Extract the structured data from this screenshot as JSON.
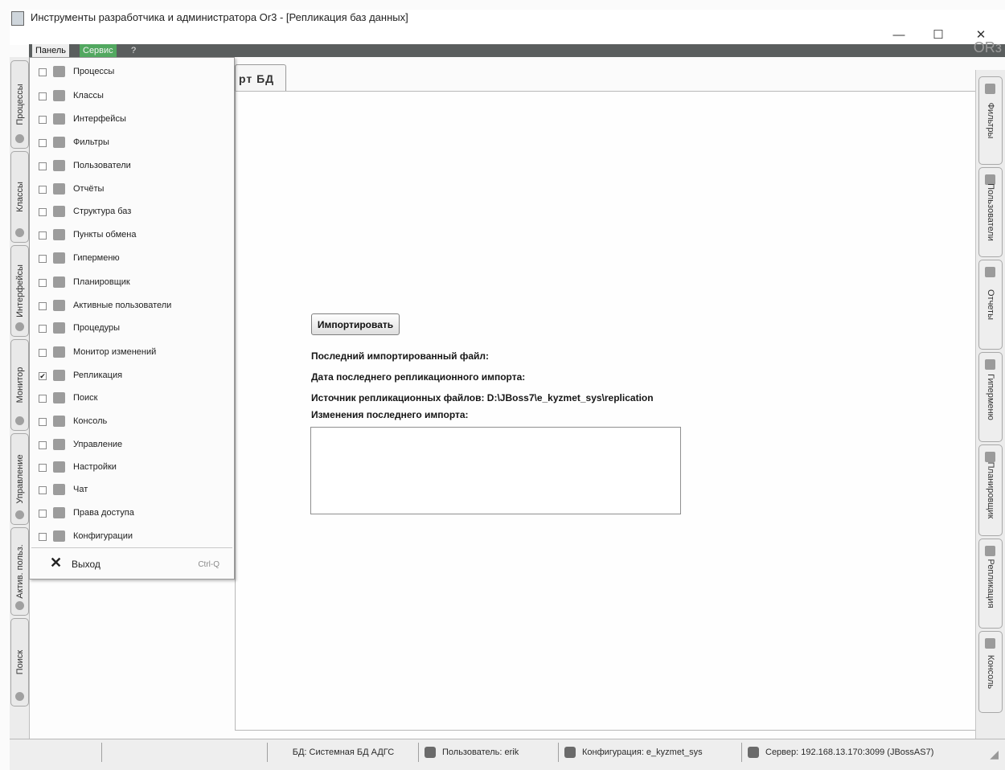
{
  "window": {
    "title": "Инструменты разработчика и администратора Or3 - [Репликация баз данных]",
    "minimize": "—",
    "maximize": "☐",
    "close": "✕"
  },
  "menubar": {
    "panel": "Панель",
    "service": "Сервис",
    "help": "?",
    "logo": "ORз"
  },
  "left_tabs": [
    "Процессы",
    "Классы",
    "Интерфейсы",
    "Монитор",
    "Управление",
    "Актив. польз.",
    "Поиск"
  ],
  "right_tabs": [
    "Фильтры",
    "Пользователи",
    "Отчеты",
    "Гиперменю",
    "Планировщик",
    "Репликация",
    "Консоль"
  ],
  "document_tab": "рт БД",
  "panel_menu": {
    "items": [
      {
        "label": "Процессы",
        "checked": false,
        "icon": "processes-icon"
      },
      {
        "label": "Классы",
        "checked": false,
        "icon": "classes-icon"
      },
      {
        "label": "Интерфейсы",
        "checked": false,
        "icon": "interfaces-icon"
      },
      {
        "label": "Фильтры",
        "checked": false,
        "icon": "filter-icon"
      },
      {
        "label": "Пользователи",
        "checked": false,
        "icon": "users-icon"
      },
      {
        "label": "Отчёты",
        "checked": false,
        "icon": "reports-icon"
      },
      {
        "label": "Структура баз",
        "checked": false,
        "icon": "database-icon"
      },
      {
        "label": "Пункты обмена",
        "checked": false,
        "icon": "exchange-icon"
      },
      {
        "label": "Гиперменю",
        "checked": false,
        "icon": "hypermenu-icon"
      },
      {
        "label": "Планировщик",
        "checked": false,
        "icon": "scheduler-icon"
      },
      {
        "label": "Активные пользователи",
        "checked": false,
        "icon": "active-users-icon"
      },
      {
        "label": "Процедуры",
        "checked": false,
        "icon": "procedures-icon"
      },
      {
        "label": "Монитор изменений",
        "checked": false,
        "icon": "monitor-icon"
      },
      {
        "label": "Репликация",
        "checked": true,
        "icon": "replication-icon"
      },
      {
        "label": "Поиск",
        "checked": false,
        "icon": "search-icon"
      },
      {
        "label": "Консоль",
        "checked": false,
        "icon": "console-icon"
      },
      {
        "label": "Управление",
        "checked": false,
        "icon": "management-icon"
      },
      {
        "label": "Настройки",
        "checked": false,
        "icon": "settings-icon"
      },
      {
        "label": "Чат",
        "checked": false,
        "icon": "chat-icon"
      },
      {
        "label": "Права доступа",
        "checked": false,
        "icon": "access-rights-icon"
      },
      {
        "label": "Конфигурации",
        "checked": false,
        "icon": "configurations-icon"
      }
    ],
    "exit_label": "Выход",
    "exit_shortcut": "Ctrl-Q"
  },
  "main": {
    "import_button": "Импортировать",
    "last_file_label": "Последний импортированный файл:",
    "last_date_label": "Дата последнего репликационного импорта:",
    "source_label": "Источник репликационных файлов: D:\\JBoss7\\e_kyzmet_sys\\replication",
    "changes_label": "Изменения последнего импорта:"
  },
  "statusbar": {
    "db": "БД: Системная БД АДГС",
    "user": "Пользователь: erik",
    "config": "Конфигурация: e_kyzmet_sys",
    "server": "Сервер: 192.168.13.170:3099 (JBossAS7)"
  }
}
